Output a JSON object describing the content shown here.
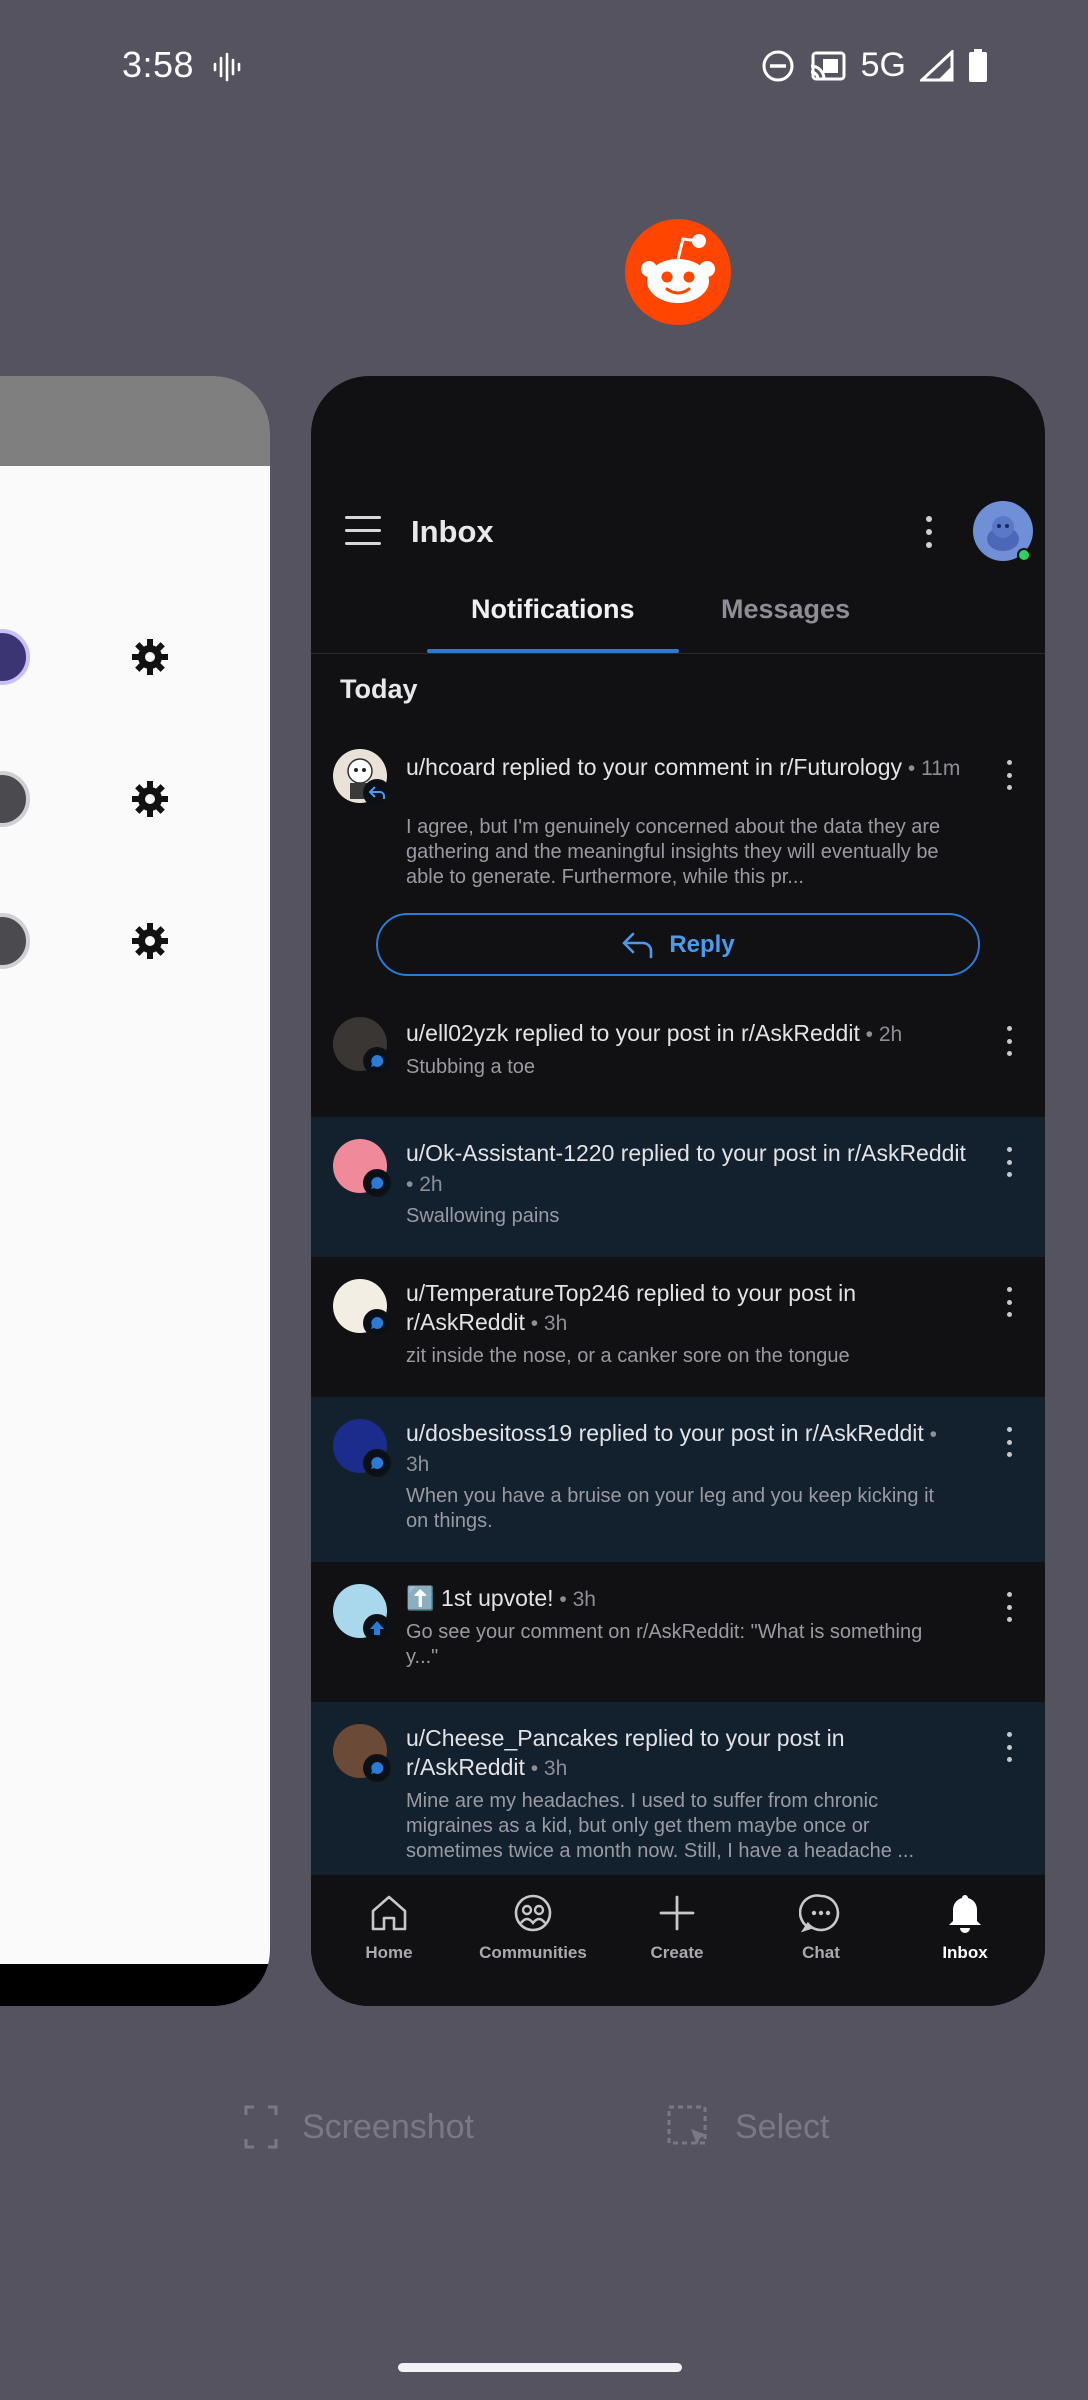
{
  "status_bar": {
    "time": "3:58",
    "network": "5G"
  },
  "inbox": {
    "title": "Inbox",
    "tabs": [
      {
        "label": "Notifications",
        "active": true
      },
      {
        "label": "Messages",
        "active": false
      }
    ],
    "section": "Today",
    "reply_label": "Reply",
    "notifications": [
      {
        "title": "u/hcoard replied to your comment in r/Futurology",
        "time": "11m",
        "body": "I agree, but I'm genuinely concerned about the data they are gathering and the meaningful insights they will eventually be able to generate. Furthermore, while this pr...",
        "unread": false,
        "has_reply": true
      },
      {
        "title": "u/ell02yzk replied to your post in r/AskReddit",
        "time": "2h",
        "body": "Stubbing a toe",
        "unread": false
      },
      {
        "title": "u/Ok-Assistant-1220 replied to your post in r/AskReddit",
        "time": "2h",
        "body": "Swallowing pains",
        "unread": true
      },
      {
        "title": "u/TemperatureTop246 replied to your post in r/AskReddit",
        "time": "3h",
        "body": "zit inside the nose, or a canker sore on the tongue",
        "unread": false
      },
      {
        "title": "u/dosbesitoss19 replied to your post in r/AskReddit",
        "time": "3h",
        "body": "When you have a bruise on your leg and you keep kicking it on things.",
        "unread": true
      },
      {
        "title": "⬆️ 1st upvote!",
        "time": "3h",
        "body": "Go see your comment on r/AskReddit: \"What is something y...\"",
        "unread": false
      },
      {
        "title": "u/Cheese_Pancakes replied to your post in r/AskReddit",
        "time": "3h",
        "body": "Mine are my headaches.  I used to suffer from chronic migraines as a kid, but only get them maybe once or sometimes twice a month now.  Still, I have a headache ...",
        "unread": true
      }
    ],
    "bottom_nav": [
      {
        "label": "Home",
        "icon": "home-icon"
      },
      {
        "label": "Communities",
        "icon": "communities-icon"
      },
      {
        "label": "Create",
        "icon": "plus-icon"
      },
      {
        "label": "Chat",
        "icon": "chat-icon"
      },
      {
        "label": "Inbox",
        "icon": "bell-icon",
        "active": true
      }
    ]
  },
  "actions": {
    "screenshot": "Screenshot",
    "select": "Select"
  },
  "colors": {
    "accent": "#2a7bd6",
    "reddit_orange": "#ff4500",
    "unread_bg": "#13212e"
  }
}
